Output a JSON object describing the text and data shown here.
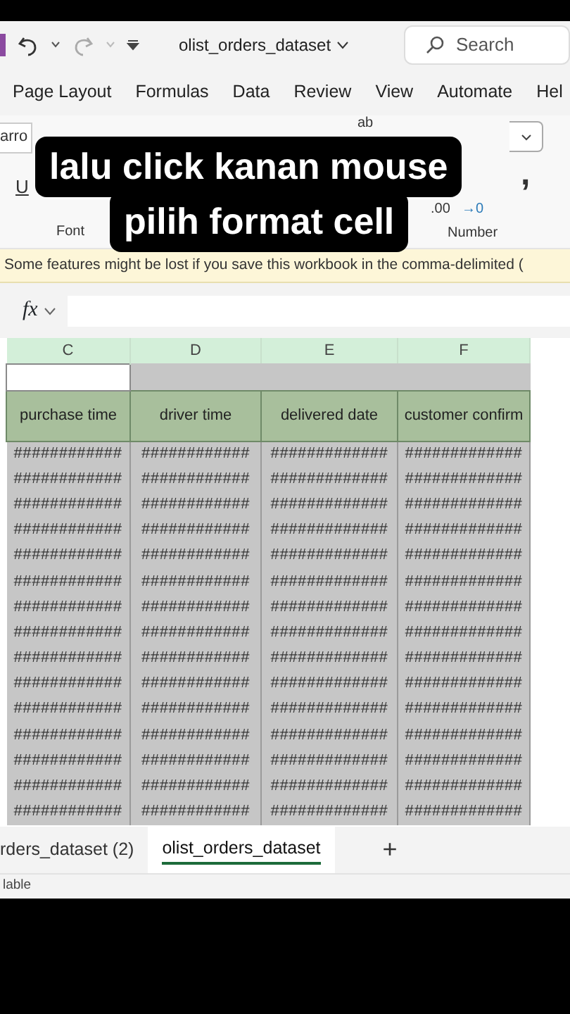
{
  "title_bar": {
    "file_name": "olist_orders_dataset",
    "search_placeholder": "Search"
  },
  "ribbon_tabs": [
    "Page Layout",
    "Formulas",
    "Data",
    "Review",
    "View",
    "Automate",
    "Hel"
  ],
  "ribbon": {
    "font_name": "arro",
    "underline": "U",
    "font_group": "Font",
    "wrap_label": "ab",
    "decimal_label": ".00",
    "decimal_arrow": "→0",
    "comma": ",",
    "number_group": "Number"
  },
  "caption": [
    "lalu click kanan mouse",
    "pilih format cell"
  ],
  "message_bar": "Some features might be lost if you save this workbook in the comma-delimited (",
  "formula_bar": {
    "fx": "fx"
  },
  "sheet": {
    "columns": [
      {
        "letter": "C",
        "top_blank": true
      },
      {
        "letter": "D",
        "top_blank": false
      },
      {
        "letter": "E",
        "top_blank": false
      },
      {
        "letter": "F",
        "top_blank": false
      }
    ],
    "headers": [
      "purchase time",
      "driver time",
      "delivered date",
      "customer confirm"
    ],
    "rows": [
      [
        "############",
        "############",
        "#############",
        "#############"
      ],
      [
        "############",
        "############",
        "#############",
        "#############"
      ],
      [
        "############",
        "############",
        "#############",
        "#############"
      ],
      [
        "############",
        "############",
        "#############",
        "#############"
      ],
      [
        "############",
        "############",
        "#############",
        "#############"
      ],
      [
        "############",
        "############",
        "#############",
        "#############"
      ],
      [
        "############",
        "############",
        "#############",
        "#############"
      ],
      [
        "############",
        "############",
        "#############",
        "#############"
      ],
      [
        "############",
        "############",
        "#############",
        "#############"
      ],
      [
        "############",
        "############",
        "#############",
        "#############"
      ],
      [
        "############",
        "############",
        "#############",
        "#############"
      ],
      [
        "############",
        "############",
        "#############",
        "#############"
      ],
      [
        "############",
        "############",
        "#############",
        "#############"
      ],
      [
        "############",
        "############",
        "#############",
        "#############"
      ],
      [
        "############",
        "############",
        "#############",
        "#############"
      ]
    ]
  },
  "sheet_tabs": [
    {
      "label": "rders_dataset (2)",
      "selected": false
    },
    {
      "label": "olist_orders_dataset",
      "selected": true
    }
  ],
  "add_sheet": "+",
  "status_bar": "lable"
}
